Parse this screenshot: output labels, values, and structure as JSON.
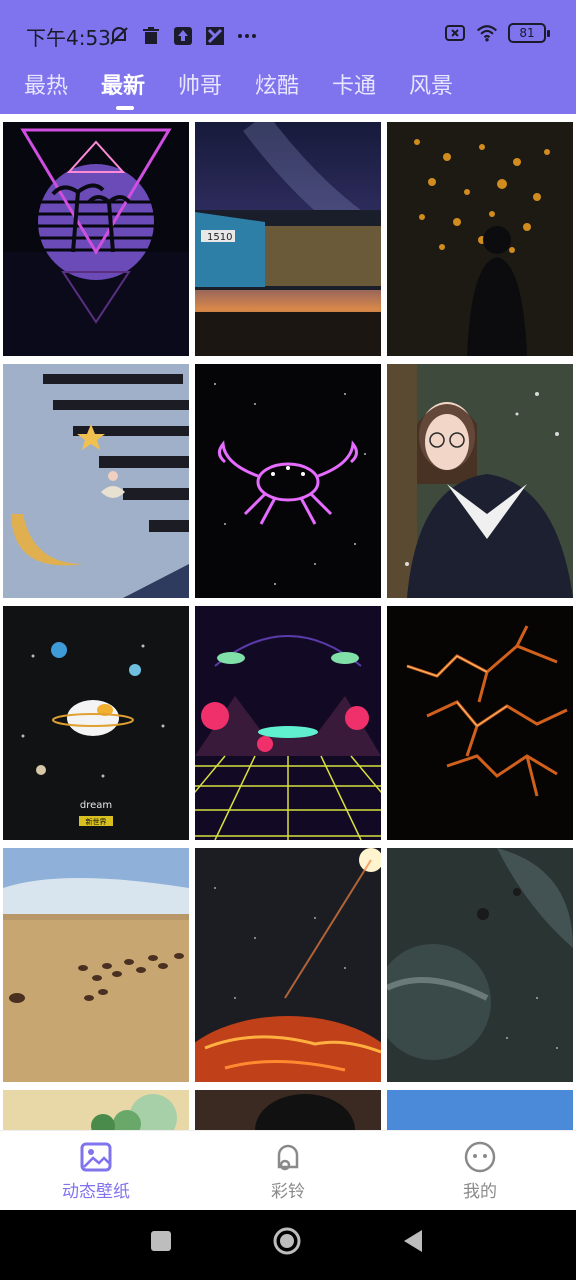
{
  "status_bar": {
    "time": "下午4:53",
    "battery": "81",
    "icons": [
      "mute-icon",
      "trash-icon",
      "upload-icon",
      "app-icon",
      "more-dots-icon",
      "sim-icon",
      "wifi-icon",
      "battery-icon"
    ]
  },
  "tabs": [
    {
      "label": "最热",
      "active": false
    },
    {
      "label": "最新",
      "active": true
    },
    {
      "label": "帅哥",
      "active": false
    },
    {
      "label": "炫酷",
      "active": false
    },
    {
      "label": "卡通",
      "active": false
    },
    {
      "label": "风景",
      "active": false
    }
  ],
  "tiles": [
    {
      "label": "dream",
      "badge": "新世界"
    }
  ],
  "train_plate": "1510",
  "bottom_nav": [
    {
      "label": "动态壁纸",
      "icon": "image-icon",
      "active": true
    },
    {
      "label": "彩铃",
      "icon": "bell-icon",
      "active": false
    },
    {
      "label": "我的",
      "icon": "smiley-icon",
      "active": false
    }
  ],
  "colors": {
    "header": "#7f73ee",
    "active_nav": "#7f73ee",
    "inactive_nav": "#8a8a8a"
  }
}
